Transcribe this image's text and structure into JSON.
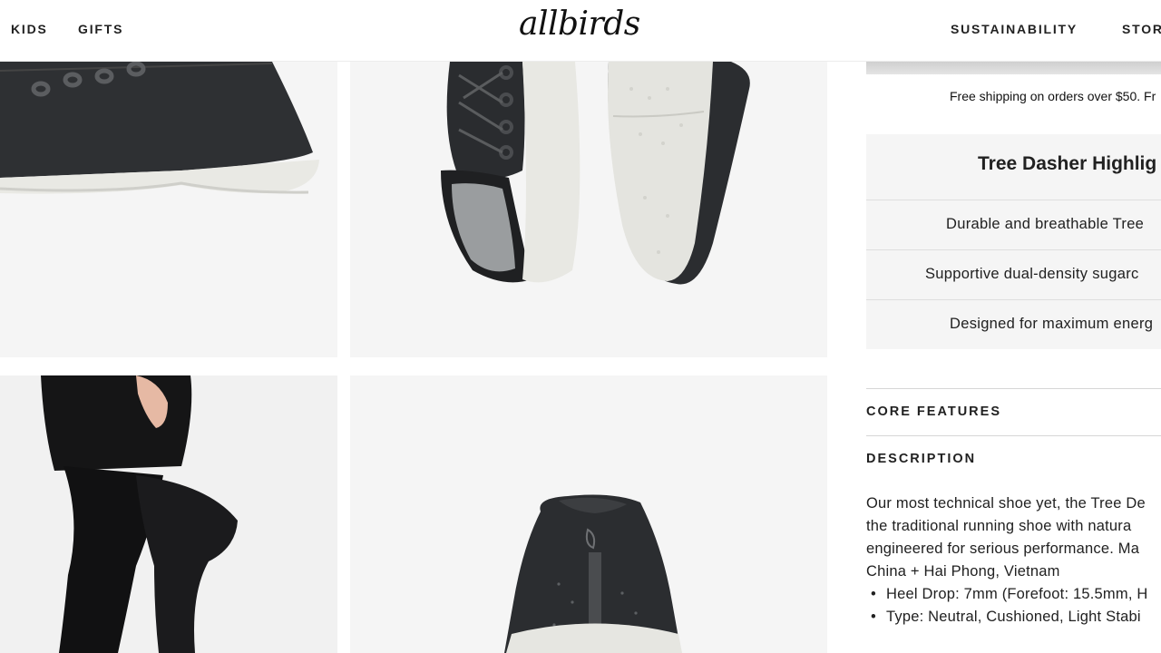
{
  "header": {
    "nav_left": [
      "KIDS",
      "GIFTS"
    ],
    "logo": "allbirds",
    "nav_right": [
      "SUSTAINABILITY",
      "STOR"
    ]
  },
  "gallery": {
    "images": [
      "shoe-side-view",
      "shoe-pair-top-and-sole",
      "runner-legs",
      "shoe-heel-view"
    ]
  },
  "product": {
    "shipping_note": "Free shipping on orders over $50. Fr",
    "highlights": {
      "title": "Tree Dasher Highlig",
      "items": [
        "Durable and breathable Tree",
        "Supportive dual-density sugarc",
        "Designed for maximum energ"
      ]
    },
    "accordions": {
      "core_features": "CORE FEATURES",
      "description": "DESCRIPTION"
    },
    "description_lines": [
      "Our most technical shoe yet, the Tree De",
      "the traditional running shoe with natura",
      "engineered for serious performance. Ma",
      "China + Hai Phong, Vietnam"
    ],
    "bullets": [
      "Heel Drop: 7mm (Forefoot: 15.5mm, H",
      "Type: Neutral, Cushioned, Light Stabi"
    ]
  }
}
